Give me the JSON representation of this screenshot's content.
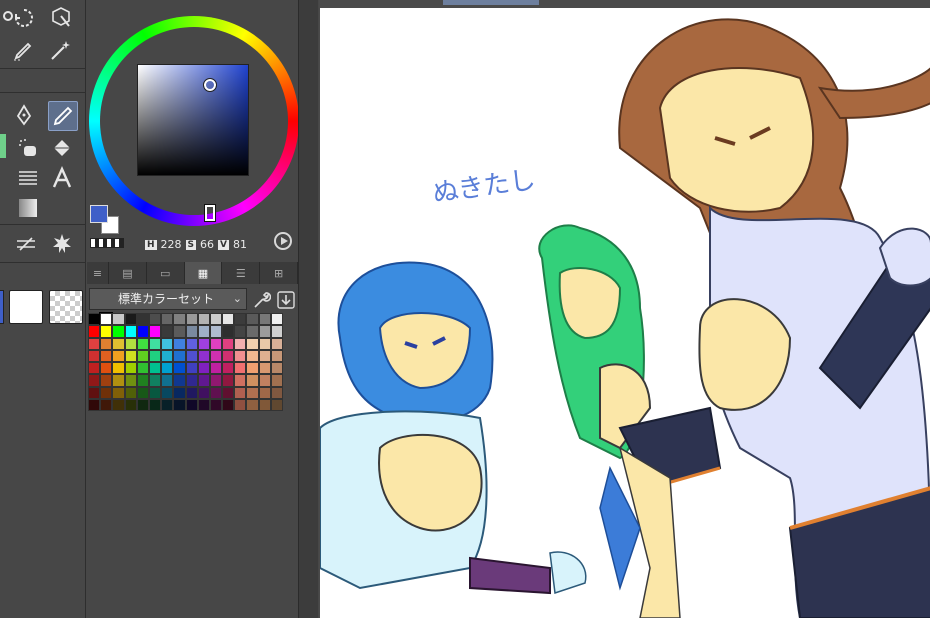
{
  "color": {
    "h": "228",
    "s": "66",
    "v": "81",
    "h_key": "H",
    "s_key": "S",
    "v_key": "V",
    "main_hex": "#3f5fc8",
    "sub_hex": "#ffffff"
  },
  "palette": {
    "set_name": "標準カラーセット",
    "colors": [
      [
        "#000000",
        "#ffffff",
        "#c8c8c8",
        "#1a1a1a",
        "#333333",
        "#4d4d4d",
        "#666666",
        "#808080",
        "#999999",
        "#b3b3b3",
        "#cccccc",
        "#e6e6e6",
        "#3c3c3c",
        "#5a5a5a",
        "#787878",
        "#f0f0f0"
      ],
      [
        "#ff0000",
        "#ffff00",
        "#00ff00",
        "#00ffff",
        "#0000ff",
        "#ff00ff",
        "#3a3a3a",
        "#5b5b5b",
        "#7a8aa0",
        "#9fb0c8",
        "#b0bcd0",
        "#2e2e2e",
        "#444444",
        "#6a6a6a",
        "#9c9c9c",
        "#d0d0d0"
      ],
      [
        "#e04040",
        "#e08030",
        "#e0c030",
        "#b0e040",
        "#40e040",
        "#40e0a0",
        "#40c0e0",
        "#4080e0",
        "#6060e0",
        "#a040e0",
        "#e040c0",
        "#e04080",
        "#f0b0b0",
        "#f0d0b0",
        "#e8c8a8",
        "#d8b098"
      ],
      [
        "#d03030",
        "#e06020",
        "#f0a020",
        "#d0e020",
        "#60d020",
        "#20d080",
        "#20b0d0",
        "#2070d0",
        "#5050d0",
        "#9030d0",
        "#d030b0",
        "#d03070",
        "#f09090",
        "#f0b890",
        "#e0b090",
        "#c89878"
      ],
      [
        "#c02020",
        "#e05010",
        "#f0c000",
        "#a0d000",
        "#30c030",
        "#00c090",
        "#00a0d0",
        "#0050d0",
        "#4040c0",
        "#8020c0",
        "#c020a0",
        "#c02060",
        "#f07070",
        "#f0a070",
        "#d89870",
        "#b88868"
      ],
      [
        "#901818",
        "#a04010",
        "#b09010",
        "#709010",
        "#208020",
        "#108060",
        "#107090",
        "#103890",
        "#302890",
        "#601890",
        "#901870",
        "#901840",
        "#d07060",
        "#d09060",
        "#c08060",
        "#a07050"
      ],
      [
        "#601010",
        "#703008",
        "#806008",
        "#506008",
        "#185818",
        "#085840",
        "#084860",
        "#082860",
        "#201860",
        "#401060",
        "#601050",
        "#601030",
        "#b06050",
        "#b07050",
        "#a06848",
        "#805840"
      ],
      [
        "#300808",
        "#401808",
        "#403008",
        "#283008",
        "#102810",
        "#082818",
        "#082028",
        "#081428",
        "#100828",
        "#200828",
        "#300828",
        "#300818",
        "#905040",
        "#906040",
        "#805838",
        "#604830"
      ]
    ]
  },
  "canvas": {
    "handwritten_text": "ぬきたし"
  },
  "tools": {
    "selected": "pen"
  }
}
